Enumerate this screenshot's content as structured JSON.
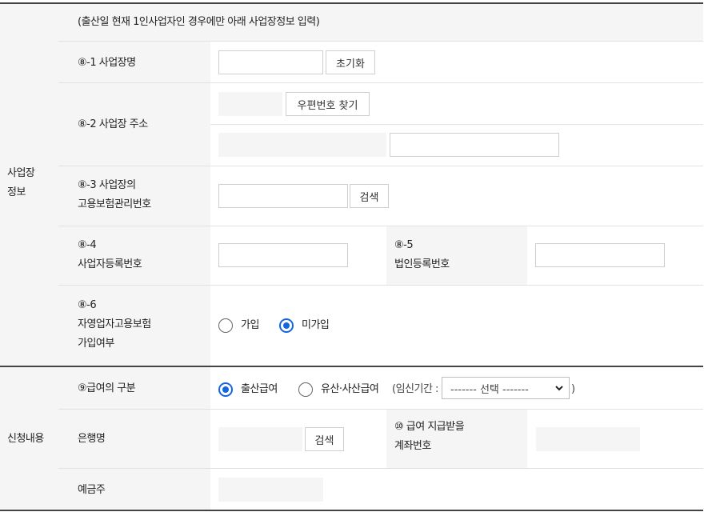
{
  "business_section": {
    "heading_line1": "사업장",
    "heading_line2": "정보",
    "notice": "(출산일 현재 1인사업자인 경우에만 아래 사업장정보 입력)",
    "row1": {
      "label": "⑧-1 사업장명",
      "input_value": "",
      "reset_button": "초기화"
    },
    "row2": {
      "label": "⑧-2 사업장 주소",
      "postcode_value": "",
      "postcode_button": "우편번호 찾기",
      "address_value": "",
      "detail_value": ""
    },
    "row3": {
      "label_line1": "⑧-3 사업장의",
      "label_line2": "고용보험관리번호",
      "input_value": "",
      "search_button": "검색"
    },
    "row4": {
      "label_line1": "⑧-4",
      "label_line2": "사업자등록번호",
      "input_value": "",
      "label5_line1": "⑧-5",
      "label5_line2": "법인등록번호",
      "input5_value": ""
    },
    "row6": {
      "label_line1": "⑧-6",
      "label_line2": "자영업자고용보험",
      "label_line3": "가입여부",
      "options": [
        "가입",
        "미가입"
      ],
      "selected": "미가입"
    }
  },
  "application_section": {
    "heading": "신청내용",
    "benefit": {
      "label": "⑨급여의 구분",
      "options": [
        "출산급여",
        "유산·사산급여"
      ],
      "selected": "출산급여",
      "pregnancy_prefix": "(임신기간 :",
      "pregnancy_select": "------- 선택 -------",
      "pregnancy_suffix": ")"
    },
    "bank": {
      "label": "은행명",
      "bank_value": "",
      "search_button": "검색",
      "account_label_line1": "⑩ 급여 지급받을",
      "account_label_line2": "계좌번호",
      "account_value": ""
    },
    "holder": {
      "label": "예금주",
      "holder_value": ""
    }
  },
  "colors": {
    "accent": "#1565e0",
    "header_bg": "#f5f5f5",
    "border": "#444444"
  }
}
